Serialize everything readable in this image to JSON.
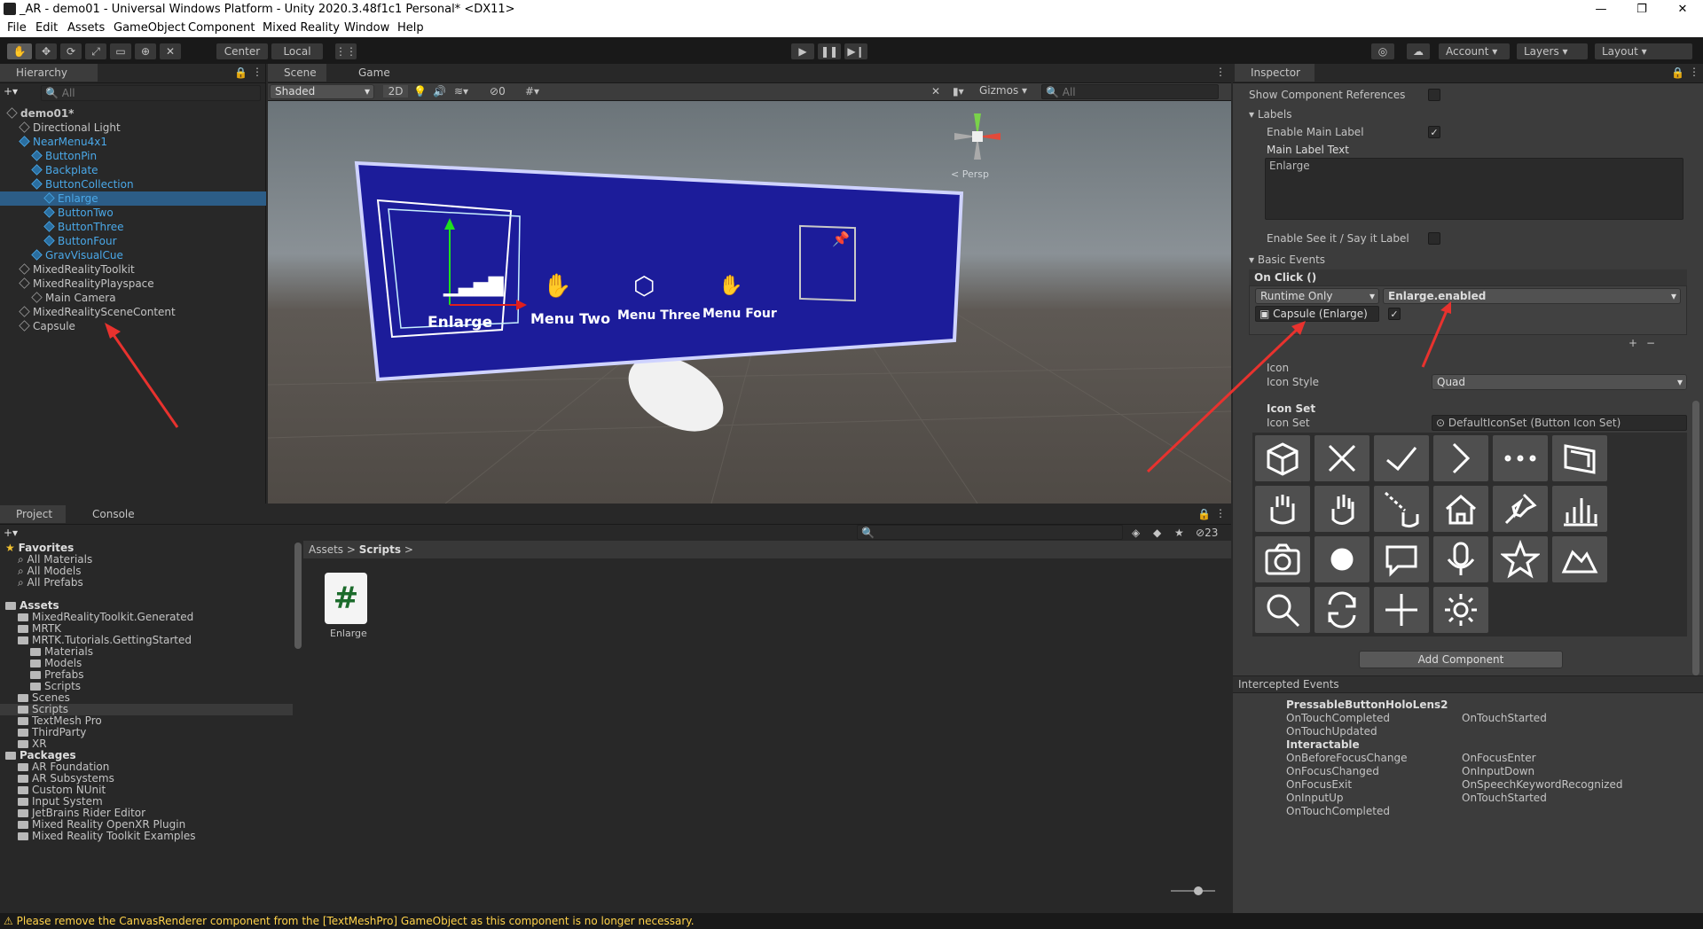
{
  "window": {
    "title": "_AR - demo01 - Universal Windows Platform - Unity 2020.3.48f1c1 Personal* <DX11>",
    "minimize": "—",
    "maximize": "❐",
    "close": "✕"
  },
  "menu": [
    "File",
    "Edit",
    "Assets",
    "GameObject",
    "Component",
    "Mixed Reality",
    "Window",
    "Help"
  ],
  "toolbar": {
    "center": "Center",
    "local": "Local",
    "account": "Account",
    "layers": "Layers",
    "layout": "Layout"
  },
  "hierarchy": {
    "tab": "Hierarchy",
    "search_placeholder": "All",
    "items": [
      {
        "label": "demo01*",
        "depth": 0,
        "kind": "scene"
      },
      {
        "label": "Directional Light",
        "depth": 1,
        "kind": "obj"
      },
      {
        "label": "NearMenu4x1",
        "depth": 1,
        "kind": "prefab"
      },
      {
        "label": "ButtonPin",
        "depth": 2,
        "kind": "prefab"
      },
      {
        "label": "Backplate",
        "depth": 2,
        "kind": "prefab"
      },
      {
        "label": "ButtonCollection",
        "depth": 2,
        "kind": "prefab"
      },
      {
        "label": "Enlarge",
        "depth": 3,
        "kind": "prefab"
      },
      {
        "label": "ButtonTwo",
        "depth": 3,
        "kind": "prefab"
      },
      {
        "label": "ButtonThree",
        "depth": 3,
        "kind": "prefab"
      },
      {
        "label": "ButtonFour",
        "depth": 3,
        "kind": "prefab"
      },
      {
        "label": "GravVisualCue",
        "depth": 2,
        "kind": "prefab"
      },
      {
        "label": "MixedRealityToolkit",
        "depth": 1,
        "kind": "obj"
      },
      {
        "label": "MixedRealityPlayspace",
        "depth": 1,
        "kind": "obj"
      },
      {
        "label": "Main Camera",
        "depth": 2,
        "kind": "obj"
      },
      {
        "label": "MixedRealitySceneContent",
        "depth": 1,
        "kind": "obj"
      },
      {
        "label": "Capsule",
        "depth": 1,
        "kind": "obj"
      }
    ]
  },
  "scene": {
    "tab_scene": "Scene",
    "tab_game": "Game",
    "shading": "Shaded",
    "mode2d": "2D",
    "hidden_count": "0",
    "gizmos": "Gizmos",
    "search_placeholder": "All",
    "persp": "< Persp",
    "menu_buttons": [
      "Enlarge",
      "Menu Two",
      "Menu Three",
      "Menu Four"
    ]
  },
  "inspector": {
    "tab": "Inspector",
    "show_refs": "Show Component References",
    "labels_header": "Labels",
    "enable_main_label": "Enable Main Label",
    "main_label_text": "Main Label Text",
    "main_label_value": "Enlarge",
    "enable_see_it": "Enable See it / Say it Label",
    "basic_events": "Basic Events",
    "on_click": "On Click ()",
    "runtime": "Runtime Only",
    "function": "Enlarge.enabled",
    "object": "Capsule (Enlarge)",
    "icon": "Icon",
    "icon_style": "Icon Style",
    "icon_style_value": "Quad",
    "icon_set_header": "Icon Set",
    "icon_set": "Icon Set",
    "icon_set_value": "DefaultIconSet (Button Icon Set)",
    "add_component": "Add Component",
    "intercepted": "Intercepted Events",
    "events_left": [
      {
        "t": "PressableButtonHoloLens2",
        "b": true
      },
      {
        "t": "OnTouchCompleted"
      },
      {
        "t": "OnTouchUpdated"
      },
      {
        "t": "Interactable",
        "b": true
      },
      {
        "t": "OnBeforeFocusChange"
      },
      {
        "t": "OnFocusChanged"
      },
      {
        "t": "OnFocusExit"
      },
      {
        "t": "OnInputUp"
      },
      {
        "t": "OnTouchCompleted"
      }
    ],
    "events_right": [
      "OnTouchStarted",
      "OnFocusEnter",
      "OnInputDown",
      "OnSpeechKeywordRecognized",
      "OnTouchStarted"
    ],
    "icons": [
      "cube-icon",
      "close-icon",
      "check-icon",
      "chevron-right-icon",
      "more-icon",
      "board-icon",
      "hand-ray-icon",
      "hand-icon",
      "far-pointer-icon",
      "home-icon",
      "pin-icon",
      "chart-icon",
      "camera-icon",
      "record-icon",
      "chat-icon",
      "microphone-icon",
      "star-icon",
      "map-icon",
      "search-icon",
      "refresh-icon",
      "plus-icon",
      "gear-icon"
    ]
  },
  "project": {
    "tab_project": "Project",
    "tab_console": "Console",
    "hidden_count": "23",
    "breadcrumb": [
      "Assets",
      "Scripts"
    ],
    "asset_name": "Enlarge",
    "tree": [
      {
        "label": "Favorites",
        "depth": 0,
        "bold": true,
        "kind": "star"
      },
      {
        "label": "All Materials",
        "depth": 1,
        "kind": "search"
      },
      {
        "label": "All Models",
        "depth": 1,
        "kind": "search"
      },
      {
        "label": "All Prefabs",
        "depth": 1,
        "kind": "search"
      },
      {
        "label": "",
        "depth": 0,
        "kind": "gap"
      },
      {
        "label": "Assets",
        "depth": 0,
        "bold": true,
        "kind": "folder"
      },
      {
        "label": "MixedRealityToolkit.Generated",
        "depth": 1,
        "kind": "folder"
      },
      {
        "label": "MRTK",
        "depth": 1,
        "kind": "folder"
      },
      {
        "label": "MRTK.Tutorials.GettingStarted",
        "depth": 1,
        "kind": "folder"
      },
      {
        "label": "Materials",
        "depth": 2,
        "kind": "folder"
      },
      {
        "label": "Models",
        "depth": 2,
        "kind": "folder"
      },
      {
        "label": "Prefabs",
        "depth": 2,
        "kind": "folder"
      },
      {
        "label": "Scripts",
        "depth": 2,
        "kind": "folder"
      },
      {
        "label": "Scenes",
        "depth": 1,
        "kind": "folder"
      },
      {
        "label": "Scripts",
        "depth": 1,
        "kind": "folder",
        "sel": true
      },
      {
        "label": "TextMesh Pro",
        "depth": 1,
        "kind": "folder"
      },
      {
        "label": "ThirdParty",
        "depth": 1,
        "kind": "folder"
      },
      {
        "label": "XR",
        "depth": 1,
        "kind": "folder"
      },
      {
        "label": "Packages",
        "depth": 0,
        "bold": true,
        "kind": "folder"
      },
      {
        "label": "AR Foundation",
        "depth": 1,
        "kind": "folder"
      },
      {
        "label": "AR Subsystems",
        "depth": 1,
        "kind": "folder"
      },
      {
        "label": "Custom NUnit",
        "depth": 1,
        "kind": "folder"
      },
      {
        "label": "Input System",
        "depth": 1,
        "kind": "folder"
      },
      {
        "label": "JetBrains Rider Editor",
        "depth": 1,
        "kind": "folder"
      },
      {
        "label": "Mixed Reality OpenXR Plugin",
        "depth": 1,
        "kind": "folder"
      },
      {
        "label": "Mixed Reality Toolkit Examples",
        "depth": 1,
        "kind": "folder"
      }
    ]
  },
  "status": {
    "warning": "Please remove the CanvasRenderer component from the [TextMeshPro] GameObject as this component is no longer necessary."
  }
}
